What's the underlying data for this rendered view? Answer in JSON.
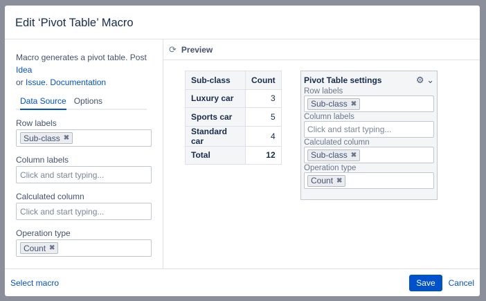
{
  "dialog": {
    "title": "Edit ‘Pivot Table’ Macro"
  },
  "left": {
    "description": {
      "text": "Macro generates a pivot table. Post",
      "idea": "Idea",
      "or": "or",
      "issue": "Issue.",
      "documentation": "Documentation"
    },
    "tabs": [
      {
        "label": "Data Source"
      },
      {
        "label": "Options"
      }
    ],
    "row_labels": {
      "label": "Row labels",
      "tag": "Sub-class"
    },
    "column_labels": {
      "label": "Column labels",
      "placeholder": "Click and start typing..."
    },
    "calculated_column": {
      "label": "Calculated column",
      "placeholder": "Click and start typing..."
    },
    "operation_type": {
      "label": "Operation type",
      "tag": "Count"
    }
  },
  "preview": {
    "label": "Preview",
    "table": {
      "headers": [
        "Sub-class",
        "Count"
      ],
      "rows": [
        {
          "label": "Luxury car",
          "value": "3"
        },
        {
          "label": "Sports car",
          "value": "5"
        },
        {
          "label": "Standard car",
          "value": "4"
        }
      ],
      "total": {
        "label": "Total",
        "value": "12"
      }
    },
    "settings": {
      "title": "Pivot Table settings",
      "row_labels": {
        "label": "Row labels",
        "tag": "Sub-class"
      },
      "column_labels": {
        "label": "Column labels",
        "placeholder": "Click and start typing..."
      },
      "calculated_column": {
        "label": "Calculated column",
        "tag": "Sub-class"
      },
      "operation_type": {
        "label": "Operation type",
        "tag": "Count"
      }
    }
  },
  "footer": {
    "select_macro": "Select macro",
    "save": "Save",
    "cancel": "Cancel"
  },
  "icons": {
    "refresh": "refresh-icon",
    "gear": "gear-icon",
    "remove": "remove-tag-icon"
  },
  "colors": {
    "accent": "#0052cc",
    "overlay": "#8a8f99"
  }
}
